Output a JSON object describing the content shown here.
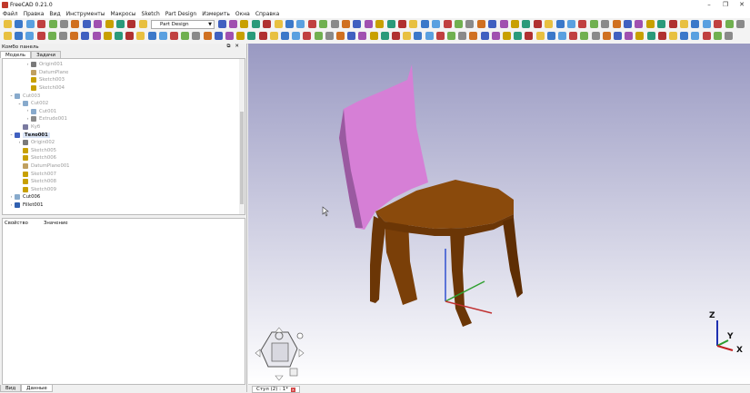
{
  "app": {
    "title": "FreeCAD 0.21.0"
  },
  "window_controls": [
    "–",
    "❐",
    "✕"
  ],
  "menu": [
    "Файл",
    "Правка",
    "Вид",
    "Инструменты",
    "Макросы",
    "Sketch",
    "Part Design",
    "Измерить",
    "Окна",
    "Справка"
  ],
  "workbench": {
    "selected": "Part Design"
  },
  "combo": {
    "title": "Комбо панель",
    "tabs": [
      "Модель",
      "Задачи"
    ]
  },
  "tree": [
    {
      "label": "Origin001",
      "indent": 2,
      "arrow": "›",
      "icon": "#7a7a7a",
      "dim": true
    },
    {
      "label": "DatumPlane",
      "indent": 2,
      "arrow": "",
      "icon": "#c0a060",
      "dim": true
    },
    {
      "label": "Sketch003",
      "indent": 2,
      "arrow": "",
      "icon": "#c8a000",
      "dim": true
    },
    {
      "label": "Sketch004",
      "indent": 2,
      "arrow": "",
      "icon": "#c8a000",
      "dim": true
    },
    {
      "label": "Cut003",
      "indent": 0,
      "arrow": "⌄",
      "icon": "#88aacc",
      "dim": true
    },
    {
      "label": "Cut002",
      "indent": 1,
      "arrow": "⌄",
      "icon": "#88aacc",
      "dim": true
    },
    {
      "label": "Cut001",
      "indent": 2,
      "arrow": "›",
      "icon": "#88aacc",
      "dim": true
    },
    {
      "label": "Extrude001",
      "indent": 2,
      "arrow": "›",
      "icon": "#8a8a8a",
      "dim": true
    },
    {
      "label": "Куб",
      "indent": 1,
      "arrow": "",
      "icon": "#7a7aa0",
      "dim": true
    },
    {
      "label": "Тело001",
      "indent": 0,
      "arrow": "⌄",
      "icon": "#4060c0",
      "bold": true,
      "selected": true
    },
    {
      "label": "Origin002",
      "indent": 1,
      "arrow": "›",
      "icon": "#7a7a7a",
      "dim": true
    },
    {
      "label": "Sketch005",
      "indent": 1,
      "arrow": "",
      "icon": "#c8a000",
      "dim": true
    },
    {
      "label": "Sketch006",
      "indent": 1,
      "arrow": "",
      "icon": "#c8a000",
      "dim": true
    },
    {
      "label": "DatumPlane001",
      "indent": 1,
      "arrow": "",
      "icon": "#c0a060",
      "dim": true
    },
    {
      "label": "Sketch007",
      "indent": 1,
      "arrow": "",
      "icon": "#c8a000",
      "dim": true
    },
    {
      "label": "Sketch008",
      "indent": 1,
      "arrow": "",
      "icon": "#c8a000",
      "dim": true
    },
    {
      "label": "Sketch009",
      "indent": 1,
      "arrow": "",
      "icon": "#c8a000",
      "dim": true
    },
    {
      "label": "Cut006",
      "indent": 0,
      "arrow": "›",
      "icon": "#88aacc"
    },
    {
      "label": "Fillet001",
      "indent": 0,
      "arrow": "›",
      "icon": "#3060b0"
    }
  ],
  "props": {
    "col_property": "Свойство",
    "col_value": "Значение"
  },
  "bottom_tabs": [
    "Вид",
    "Данные"
  ],
  "view_tab": {
    "label": "Стул (2) : 1*"
  },
  "axes": {
    "x": "X",
    "y": "Y",
    "z": "Z"
  },
  "colors": {
    "back": "#d67fd6",
    "seat": "#8a4a0c"
  }
}
